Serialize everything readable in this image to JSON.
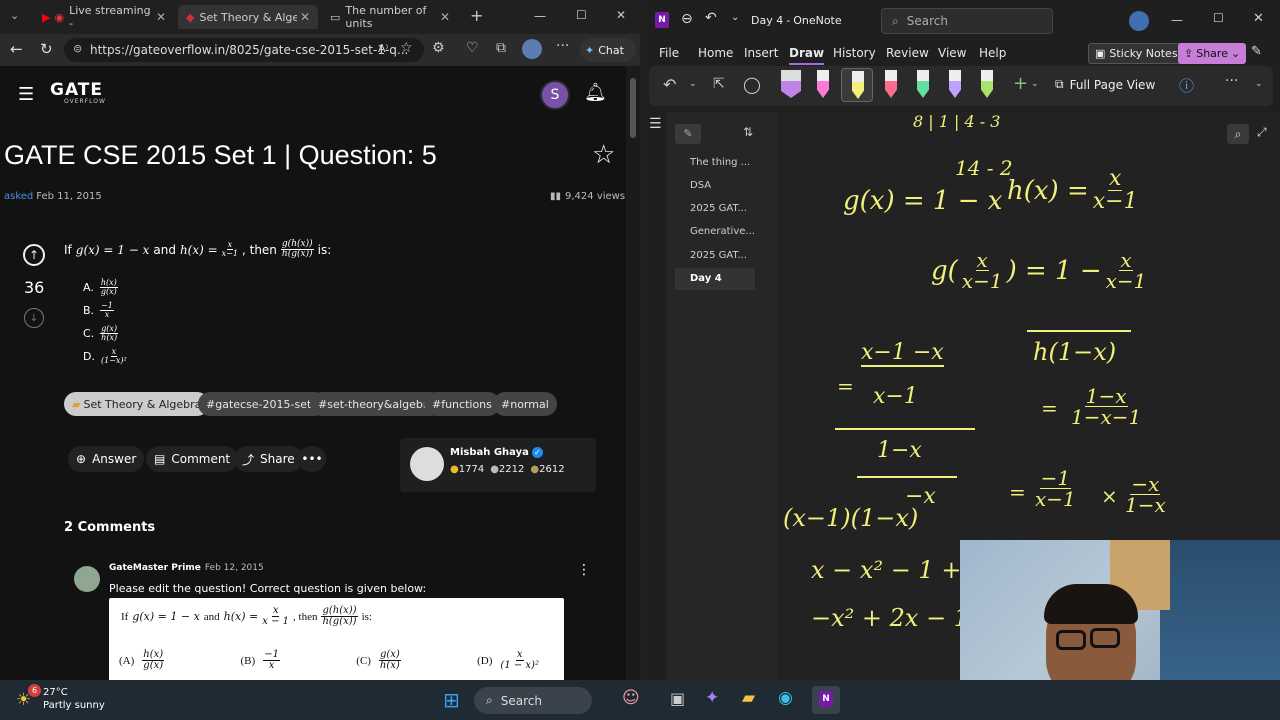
{
  "browser": {
    "tabs": [
      {
        "label": "Live streaming -"
      },
      {
        "label": "Set Theory & Algebr"
      },
      {
        "label": "The number of units"
      }
    ],
    "url": "https://gateoverflow.in/8025/gate-cse-2015-set-1-q...",
    "chat_label": "Chat"
  },
  "site": {
    "logo": "GATE",
    "logo_sub": "OVERFLOW",
    "avatar_letter": "S",
    "title": "GATE CSE 2015 Set 1 | Question: 5",
    "asked_label": "asked",
    "asked_date": "Feb 11, 2015",
    "views": "9,424 views",
    "votes": "36",
    "question": {
      "prefix": "If",
      "g_def": "g(x) = 1 − x",
      "and": "and",
      "h_def": "h(x) =",
      "h_num": "x",
      "h_den": "x−1",
      "then": ", then",
      "expr_num": "g(h(x))",
      "expr_den": "h(g(x))",
      "suffix": "is:"
    },
    "options": [
      {
        "letter": "A.",
        "num": "h(x)",
        "den": "g(x)"
      },
      {
        "letter": "B.",
        "num": "−1",
        "den": "x"
      },
      {
        "letter": "C.",
        "num": "g(x)",
        "den": "h(x)"
      },
      {
        "letter": "D.",
        "num": "x",
        "den": "(1−x)²"
      }
    ],
    "tags": [
      "Set Theory & Algebra",
      "#gatecse-2015-set1",
      "#set-theory&algebra",
      "#functions",
      "#normal"
    ],
    "actions": [
      "Answer",
      "Comment",
      "Share"
    ],
    "author": {
      "name": "Misbah Ghaya",
      "gold": "1774",
      "silver": "2212",
      "bronze": "2612"
    },
    "comments_heading": "2 Comments",
    "comment": {
      "author": "GateMaster Prime",
      "date": "Feb 12, 2015",
      "text": "Please edit the question! Correct question is given below:",
      "box_prefix": "If",
      "box_g": "g(x) = 1 − x",
      "box_and": "and",
      "box_h": "h(x) =",
      "box_h_num": "x",
      "box_h_den": "x − 1",
      "box_then": ", then",
      "box_num": "g(h(x))",
      "box_den": "h(g(x))",
      "box_is": "is:",
      "box_options": [
        {
          "letter": "(A)",
          "num": "h(x)",
          "den": "g(x)"
        },
        {
          "letter": "(B)",
          "num": "−1",
          "den": "x"
        },
        {
          "letter": "(C)",
          "num": "g(x)",
          "den": "h(x)"
        },
        {
          "letter": "(D)",
          "num": "x",
          "den": "(1 − x)²"
        }
      ]
    }
  },
  "onenote": {
    "title": "Day 4",
    "app": "OneNote",
    "search_placeholder": "Search",
    "menu": [
      "File",
      "Home",
      "Insert",
      "Draw",
      "History",
      "Review",
      "View",
      "Help"
    ],
    "sticky_notes": "Sticky Notes",
    "share": "Share",
    "full_page_view": "Full Page View",
    "pages": [
      "The thing ...",
      "DSA",
      "2025 GAT...",
      "Generative...",
      "2025 GAT...",
      "Day 4"
    ],
    "ink": {
      "l1": "8 | 1 | 4 - 3",
      "l2": "14 - 2",
      "g_def": "g(x) = 1 − x",
      "h_def": "h(x) =",
      "h_num": "x",
      "h_den": "x−1",
      "g_of": "g(",
      "g_num": "x",
      "g_den": "x−1",
      "g_eq": ") = 1 −",
      "g_rnum": "x",
      "g_rden": "x−1",
      "hb": "h(1−x)",
      "eq": "=",
      "a_num": "1−x",
      "a_den": "1−x−1",
      "b_top": "x−1 −x",
      "b_mid": "x−1",
      "b_bot": "1−x",
      "neg_x": "−x",
      "c_num": "−1",
      "c_den": "x−1",
      "times": "×",
      "d_num": "−x",
      "d_den": "1−x",
      "prod": "(x−1)(1−x)",
      "exp1": "x − x² − 1 + x",
      "exp2": "−x² + 2x − 1"
    },
    "colors": {
      "ink": "#f0f07a",
      "accent": "#7719aa"
    }
  },
  "taskbar": {
    "temp": "27°C",
    "weather": "Partly sunny",
    "badge": "6",
    "search": "Search"
  }
}
